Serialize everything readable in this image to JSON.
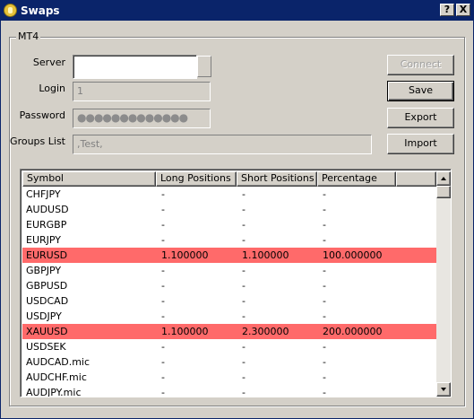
{
  "window": {
    "title": "Swaps",
    "help_label": "?",
    "close_label": "X"
  },
  "group": {
    "label": "MT4"
  },
  "form": {
    "server_label": "Server",
    "server_value": "",
    "login_label": "Login",
    "login_value": "1",
    "password_label": "Password",
    "password_value": "●●●●●●●●●●●●●",
    "groups_label": "Groups List",
    "groups_value": ",Test,"
  },
  "buttons": {
    "connect": "Connect",
    "save": "Save",
    "export": "Export",
    "import": "Import"
  },
  "table": {
    "columns": [
      "Symbol",
      "Long Positions",
      "Short Positions",
      "Percentage"
    ],
    "highlight_color": "#ff6a6a",
    "rows": [
      {
        "symbol": "CHFJPY",
        "long": "-",
        "short": "-",
        "pct": "-",
        "highlight": false
      },
      {
        "symbol": "AUDUSD",
        "long": "-",
        "short": "-",
        "pct": "-",
        "highlight": false
      },
      {
        "symbol": "EURGBP",
        "long": "-",
        "short": "-",
        "pct": "-",
        "highlight": false
      },
      {
        "symbol": "EURJPY",
        "long": "-",
        "short": "-",
        "pct": "-",
        "highlight": false
      },
      {
        "symbol": "EURUSD",
        "long": "1.100000",
        "short": "1.100000",
        "pct": "100.000000",
        "highlight": true
      },
      {
        "symbol": "GBPJPY",
        "long": "-",
        "short": "-",
        "pct": "-",
        "highlight": false
      },
      {
        "symbol": "GBPUSD",
        "long": "-",
        "short": "-",
        "pct": "-",
        "highlight": false
      },
      {
        "symbol": "USDCAD",
        "long": "-",
        "short": "-",
        "pct": "-",
        "highlight": false
      },
      {
        "symbol": "USDJPY",
        "long": "-",
        "short": "-",
        "pct": "-",
        "highlight": false
      },
      {
        "symbol": "XAUUSD",
        "long": "1.100000",
        "short": "2.300000",
        "pct": "200.000000",
        "highlight": true
      },
      {
        "symbol": "USDSEK",
        "long": "-",
        "short": "-",
        "pct": "-",
        "highlight": false
      },
      {
        "symbol": "AUDCAD.mic",
        "long": "-",
        "short": "-",
        "pct": "-",
        "highlight": false
      },
      {
        "symbol": "AUDCHF.mic",
        "long": "-",
        "short": "-",
        "pct": "-",
        "highlight": false
      },
      {
        "symbol": "AUDJPY.mic",
        "long": "-",
        "short": "-",
        "pct": "-",
        "highlight": false
      }
    ]
  }
}
